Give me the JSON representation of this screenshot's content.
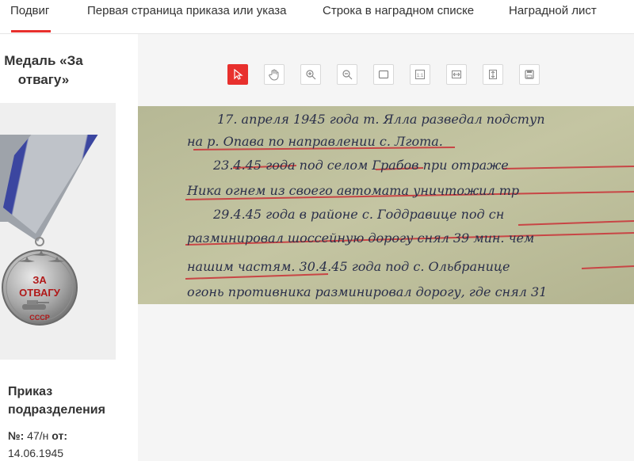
{
  "tabs": [
    {
      "label": "Подвиг",
      "active": true
    },
    {
      "label": "Первая страница приказа или указа",
      "active": false
    },
    {
      "label": "Строка в наградном списке",
      "active": false
    },
    {
      "label": "Наградной лист",
      "active": false
    }
  ],
  "sidebar": {
    "award_title": "Медаль «За отвагу»",
    "order_title": "Приказ подразделения",
    "order_number_label": "№:",
    "order_number": "47/н",
    "order_from_label": "от:",
    "order_date": "14.06.1945"
  },
  "medal": {
    "inscription_line1": "ЗА",
    "inscription_line2": "ОТВАГУ",
    "bottom_text": "СССР"
  },
  "toolbar": {
    "tools": [
      "pointer",
      "hand",
      "zoom-in",
      "zoom-out",
      "fit-page",
      "actual-size",
      "fit-width",
      "fit-height",
      "save"
    ],
    "accent": "#e8302d"
  },
  "document": {
    "lines": [
      "17. апреля 1945 года т. Ялла разведал подступ",
      "на р. Опава по направлении с. Лгота.",
      "23.4.45 года под селом Грабов при отраже",
      "Ника огнем из своего автомата уничтожил тр",
      "29.4.45 года в районе с. Годдравице под сн",
      "разминировал шоссейную дорогу снял 39 мин. чем",
      "нашим частям. 30.4.45 года под с. Ольбранице",
      "огонь противника разминировал дорогу, где снял 31"
    ]
  }
}
